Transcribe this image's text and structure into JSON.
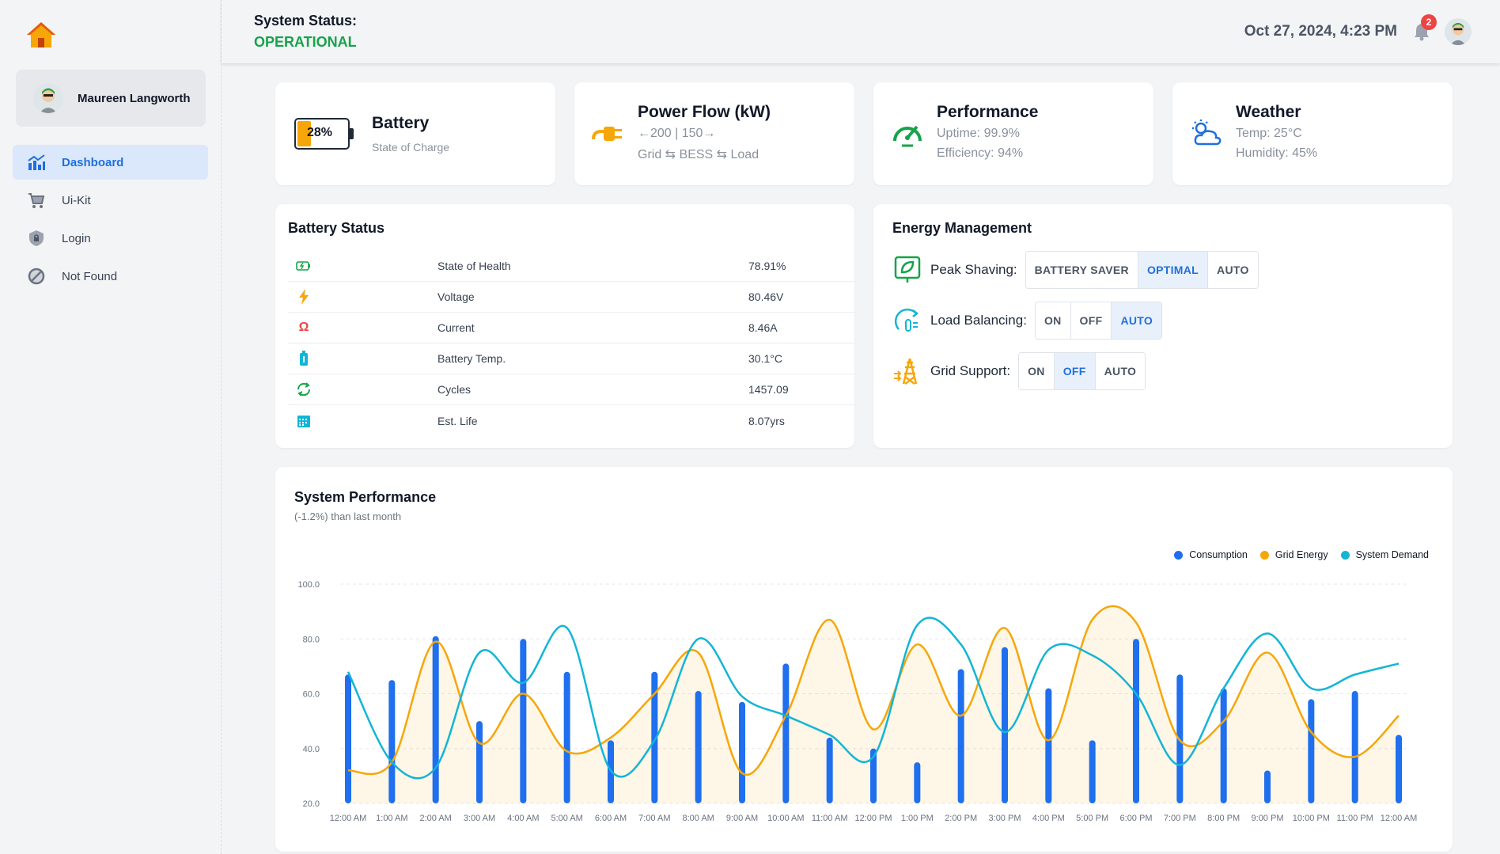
{
  "sidebar": {
    "user_name": "Maureen Langworth",
    "items": [
      {
        "label": "Dashboard",
        "icon": "chart-icon",
        "active": true
      },
      {
        "label": "Ui-Kit",
        "icon": "cart-icon",
        "active": false
      },
      {
        "label": "Login",
        "icon": "shield-lock-icon",
        "active": false
      },
      {
        "label": "Not Found",
        "icon": "block-icon",
        "active": false
      }
    ]
  },
  "header": {
    "status_label": "System Status:",
    "status_value": "OPERATIONAL",
    "datetime": "Oct 27, 2024, 4:23 PM",
    "notification_count": "2"
  },
  "stats": {
    "battery": {
      "title": "Battery",
      "subtitle": "State of Charge",
      "percent_label": "28%",
      "level": 28
    },
    "power": {
      "title": "Power Flow (kW)",
      "line1": "←200 | 150→",
      "line2": "Grid ⇆ BESS ⇆ Load"
    },
    "performance": {
      "title": "Performance",
      "line1": "Uptime: 99.9%",
      "line2": "Efficiency: 94%"
    },
    "weather": {
      "title": "Weather",
      "line1": "Temp: 25°C",
      "line2": "Humidity: 45%"
    }
  },
  "battery_status": {
    "title": "Battery Status",
    "rows": [
      {
        "icon": "battery-charging-icon",
        "label": "State of Health",
        "value": "78.91%"
      },
      {
        "icon": "bolt-icon",
        "label": "Voltage",
        "value": "80.46V"
      },
      {
        "icon": "omega-icon",
        "label": "Current",
        "value": "8.46A"
      },
      {
        "icon": "thermometer-battery-icon",
        "label": "Battery Temp.",
        "value": "30.1°C"
      },
      {
        "icon": "cycle-icon",
        "label": "Cycles",
        "value": "1457.09"
      },
      {
        "icon": "calendar-icon",
        "label": "Est. Life",
        "value": "8.07yrs"
      }
    ]
  },
  "energy_management": {
    "title": "Energy Management",
    "controls": [
      {
        "label": "Peak Shaving:",
        "icon": "peak-shaving-icon",
        "options": [
          "BATTERY SAVER",
          "OPTIMAL",
          "AUTO"
        ],
        "selected": "OPTIMAL"
      },
      {
        "label": "Load Balancing:",
        "icon": "load-balancing-icon",
        "options": [
          "ON",
          "OFF",
          "AUTO"
        ],
        "selected": "AUTO"
      },
      {
        "label": "Grid Support:",
        "icon": "grid-tower-icon",
        "options": [
          "ON",
          "OFF",
          "AUTO"
        ],
        "selected": "OFF"
      }
    ]
  },
  "system_performance": {
    "title": "System Performance",
    "subtitle": "(-1.2%) than last month"
  },
  "colors": {
    "consumption": "#1f6fee",
    "grid_energy": "#f6a609",
    "system_demand": "#13b5d6",
    "accent": "#1f6fde",
    "status_ok": "#16a34a"
  },
  "chart_data": {
    "type": "bar",
    "categories": [
      "12:00 AM",
      "1:00 AM",
      "2:00 AM",
      "3:00 AM",
      "4:00 AM",
      "5:00 AM",
      "6:00 AM",
      "7:00 AM",
      "8:00 AM",
      "9:00 AM",
      "10:00 AM",
      "11:00 AM",
      "12:00 PM",
      "1:00 PM",
      "2:00 PM",
      "3:00 PM",
      "4:00 PM",
      "5:00 PM",
      "6:00 PM",
      "7:00 PM",
      "8:00 PM",
      "9:00 PM",
      "10:00 PM",
      "11:00 PM",
      "12:00 AM"
    ],
    "series": [
      {
        "name": "Consumption",
        "type": "bar",
        "values": [
          67,
          65,
          81,
          50,
          80,
          68,
          43,
          68,
          61,
          57,
          71,
          44,
          40,
          35,
          69,
          77,
          62,
          43,
          80,
          67,
          62,
          32,
          58,
          61,
          45
        ]
      },
      {
        "name": "Grid Energy",
        "type": "area",
        "values": [
          32,
          35,
          79,
          42,
          60,
          39,
          44,
          60,
          75,
          31,
          52,
          87,
          47,
          78,
          52,
          84,
          43,
          87,
          86,
          43,
          50,
          75,
          46,
          37,
          52
        ]
      },
      {
        "name": "System Demand",
        "type": "line",
        "values": [
          68,
          35,
          33,
          75,
          64,
          84,
          32,
          43,
          80,
          59,
          52,
          45,
          37,
          85,
          78,
          46,
          76,
          74,
          60,
          34,
          62,
          82,
          62,
          67,
          71
        ]
      }
    ],
    "ylim": [
      20,
      100
    ],
    "yticks": [
      "20.0",
      "40.0",
      "60.0",
      "80.0",
      "100.0"
    ],
    "grid": true,
    "legend": "top-right"
  }
}
